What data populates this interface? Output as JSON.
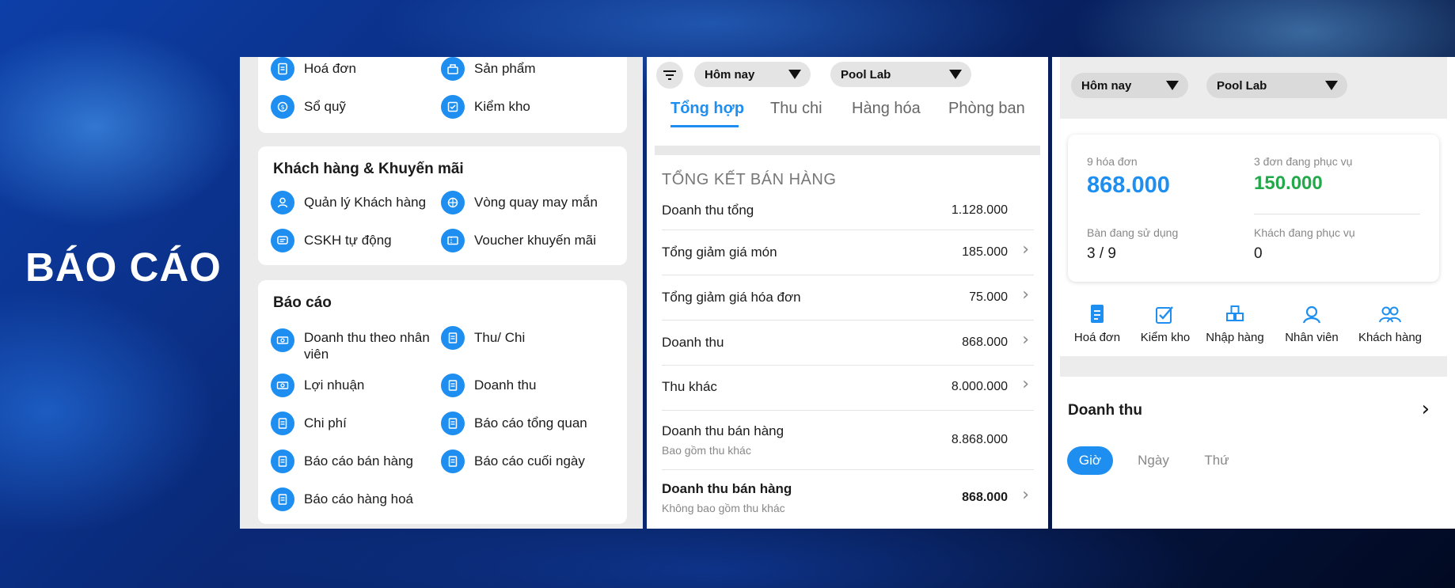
{
  "headline": "BÁO CÁO",
  "panel_menu": {
    "top_items": [
      {
        "label": "Hoá đơn",
        "icon": "invoice-icon"
      },
      {
        "label": "Sản phẩm",
        "icon": "product-icon"
      },
      {
        "label": "Sổ quỹ",
        "icon": "cashbook-icon"
      },
      {
        "label": "Kiểm kho",
        "icon": "inventory-check-icon"
      }
    ],
    "customer_section": {
      "title": "Khách hàng & Khuyến mãi",
      "items": [
        {
          "label": "Quản lý Khách hàng",
          "icon": "customer-manage-icon"
        },
        {
          "label": "Vòng quay may mắn",
          "icon": "lucky-wheel-icon"
        },
        {
          "label": "CSKH tự động",
          "icon": "auto-care-icon"
        },
        {
          "label": "Voucher khuyến mãi",
          "icon": "voucher-icon"
        }
      ]
    },
    "report_section": {
      "title": "Báo cáo",
      "items": [
        {
          "label": "Doanh thu theo nhân viên",
          "icon": "cash-icon"
        },
        {
          "label": "Thu/ Chi",
          "icon": "document-icon"
        },
        {
          "label": "Lợi nhuận",
          "icon": "cash-icon"
        },
        {
          "label": "Doanh thu",
          "icon": "document-icon"
        },
        {
          "label": "Chi phí",
          "icon": "document-icon"
        },
        {
          "label": "Báo cáo tổng quan",
          "icon": "document-icon"
        },
        {
          "label": "Báo cáo bán hàng",
          "icon": "document-icon"
        },
        {
          "label": "Báo cáo cuối ngày",
          "icon": "document-icon"
        },
        {
          "label": "Báo cáo hàng hoá",
          "icon": "document-icon"
        }
      ]
    }
  },
  "panel_summary": {
    "filters": {
      "period": "Hôm nay",
      "store": "Pool Lab"
    },
    "tabs": [
      "Tổng hợp",
      "Thu chi",
      "Hàng hóa",
      "Phòng ban"
    ],
    "active_tab": "Tổng hợp",
    "section_title": "TỔNG KẾT BÁN HÀNG",
    "rows": [
      {
        "label": "Doanh thu tổng",
        "value": "1.128.000",
        "sub": "",
        "chevron": false,
        "bold": false
      },
      {
        "label": "Tổng giảm giá món",
        "value": "185.000",
        "sub": "",
        "chevron": true,
        "bold": false
      },
      {
        "label": "Tổng giảm giá hóa đơn",
        "value": "75.000",
        "sub": "",
        "chevron": true,
        "bold": false
      },
      {
        "label": "Doanh thu",
        "value": "868.000",
        "sub": "",
        "chevron": true,
        "bold": false
      },
      {
        "label": "Thu khác",
        "value": "8.000.000",
        "sub": "",
        "chevron": true,
        "bold": false
      },
      {
        "label": "Doanh thu bán hàng",
        "value": "8.868.000",
        "sub": "Bao gồm thu khác",
        "chevron": false,
        "bold": false
      },
      {
        "label": "Doanh thu bán hàng",
        "value": "868.000",
        "sub": "Không bao gồm thu khác",
        "chevron": true,
        "bold": true
      }
    ]
  },
  "panel_dashboard": {
    "filters": {
      "period": "Hôm nay",
      "store": "Pool Lab"
    },
    "stats": {
      "invoices_label": "9 hóa đơn",
      "invoices_value": "868.000",
      "serving_label": "3 đơn đang phục vụ",
      "serving_value": "150.000",
      "tables_label": "Bàn đang sử dụng",
      "tables_value": "3 / 9",
      "guests_label": "Khách đang phục vụ",
      "guests_value": "0"
    },
    "quick_actions": [
      {
        "label": "Hoá đơn",
        "icon": "invoice-icon"
      },
      {
        "label": "Kiểm kho",
        "icon": "inventory-check-icon"
      },
      {
        "label": "Nhập hàng",
        "icon": "import-goods-icon"
      },
      {
        "label": "Nhân viên",
        "icon": "staff-icon"
      },
      {
        "label": "Khách hàng",
        "icon": "customer-icon"
      }
    ],
    "revenue_title": "Doanh thu",
    "segments": [
      "Giờ",
      "Ngày",
      "Thứ"
    ],
    "active_segment": "Giờ"
  },
  "colors": {
    "accent": "#1e8ff0",
    "green": "#22a94a",
    "background_dark": "#061a4f"
  }
}
